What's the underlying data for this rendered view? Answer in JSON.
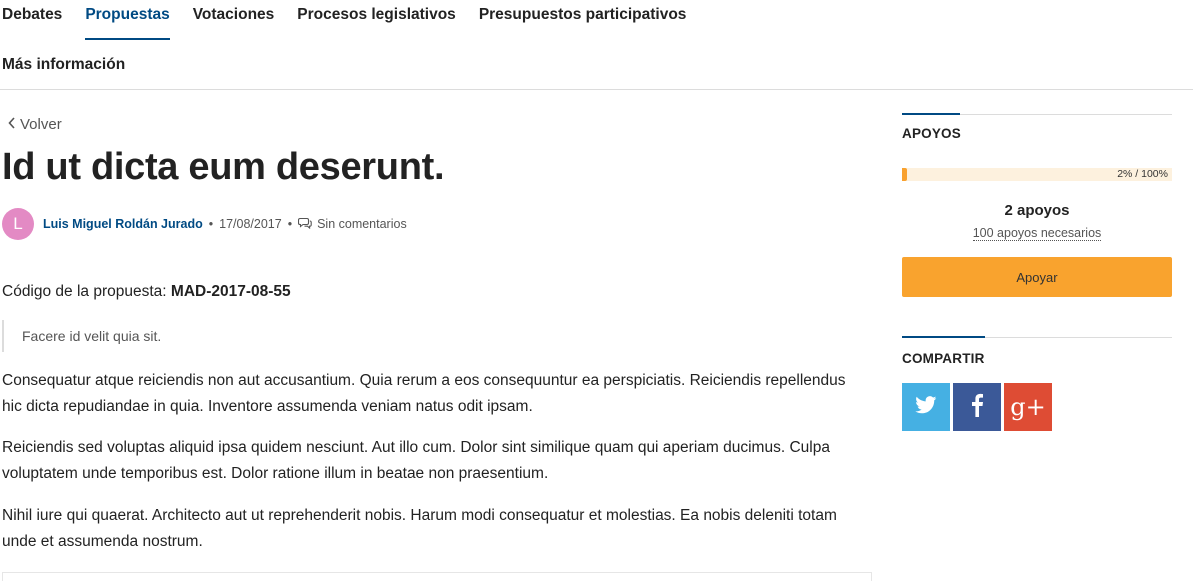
{
  "nav": {
    "items": [
      {
        "label": "Debates",
        "active": false
      },
      {
        "label": "Propuestas",
        "active": true
      },
      {
        "label": "Votaciones",
        "active": false
      },
      {
        "label": "Procesos legislativos",
        "active": false
      },
      {
        "label": "Presupuestos participativos",
        "active": false
      }
    ],
    "more": "Más información",
    "active_color": "#004a83"
  },
  "proposal": {
    "back": "Volver",
    "title": "Id ut dicta eum deserunt.",
    "avatar_letter": "L",
    "avatar_color": "#e38ac4",
    "author": "Luis Miguel Roldán Jurado",
    "date": "17/08/2017",
    "comments": "Sin comentarios",
    "code_label": "Código de la propuesta:",
    "code": "MAD-2017-08-55",
    "summary": "Facere id velit quia sit.",
    "paragraphs": [
      "Consequatur atque reiciendis non aut accusantium. Quia rerum a eos consequuntur ea perspiciatis. Reiciendis repellendus hic dicta repudiandae in quia. Inventore assumenda veniam natus odit ipsam.",
      "Reiciendis sed voluptas aliquid ipsa quidem nesciunt. Aut illo cum. Dolor sint similique quam qui aperiam ducimus. Culpa voluptatem unde temporibus est. Dolor ratione illum in beatae non praesentium.",
      "Nihil iure qui quaerat. Architecto aut ut reprehenderit nobis. Harum modi consequatur et molestias. Ea nobis deleniti totam unde et assumenda nostrum."
    ]
  },
  "sidebar": {
    "supports_heading": "APOYOS",
    "progress_percent": 2,
    "progress_label": "2% / 100%",
    "votes": "2 apoyos",
    "needed": "100 apoyos necesarios",
    "support_button": "Apoyar",
    "support_color": "#f9a32e",
    "share_heading": "COMPARTIR",
    "share": [
      {
        "icon": "twitter-icon",
        "color": "#45b0e3"
      },
      {
        "icon": "facebook-icon",
        "color": "#3b5998"
      },
      {
        "icon": "google-plus-icon",
        "color": "#de4c34",
        "glyph": "g+"
      }
    ]
  }
}
